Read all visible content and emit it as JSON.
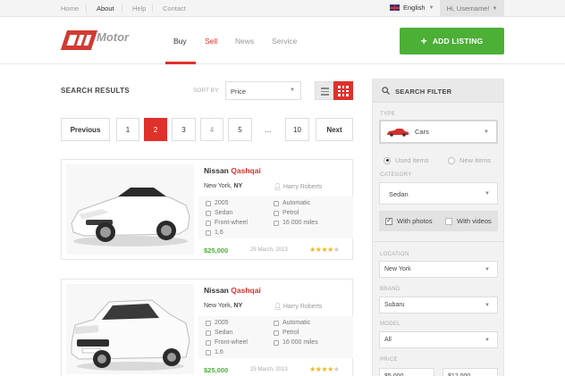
{
  "topnav": {
    "links": [
      "Home",
      "About",
      "Help",
      "Contact"
    ],
    "active": "About",
    "language": "English",
    "user": "Hi, Username!"
  },
  "header": {
    "logo_text": "Motor",
    "nav": [
      "Buy",
      "Sell",
      "News",
      "Service"
    ],
    "active_nav": "Buy",
    "add_listing": "ADD LISTING"
  },
  "results": {
    "title": "SEARCH RESULTS",
    "sort_label": "SORT BY:",
    "sort_value": "Price"
  },
  "pagination": {
    "previous": "Previous",
    "pages": [
      "1",
      "2",
      "3",
      "4",
      "5",
      "...",
      "10"
    ],
    "active_page": "2",
    "next": "Next"
  },
  "listings": [
    {
      "make": "Nissan",
      "model": "Qashqai",
      "city": "New York,",
      "state": "NY",
      "seller": "Harry Roberts",
      "year": "2005",
      "body": "Sedan",
      "drive": "Front-wheel",
      "engine": "1,6",
      "transmission": "Automatic",
      "fuel": "Petrol",
      "mileage": "16 000 miles",
      "price": "$25,000",
      "date": "25 March, 2013",
      "rating": 4
    },
    {
      "make": "Nissan",
      "model": "Qashqai",
      "city": "New York,",
      "state": "NY",
      "seller": "Harry Roberts",
      "year": "2005",
      "body": "Sedan",
      "drive": "Front-wheel",
      "engine": "1,6",
      "transmission": "Automatic",
      "fuel": "Petrol",
      "mileage": "16 000 miles",
      "price": "$25,000",
      "date": "25 March, 2013",
      "rating": 4
    }
  ],
  "filter": {
    "title": "SEARCH FILTER",
    "type_label": "TYPE",
    "type_value": "Cars",
    "used": "Used items",
    "new": "New items",
    "category_label": "CATEGORY",
    "category_value": "Sedan",
    "with_photos": "With photos",
    "with_videos": "With videos",
    "location_label": "LOCATION",
    "location_value": "New York",
    "brand_label": "BRAND",
    "brand_value": "Subaru",
    "model_label": "MODEL",
    "model_value": "All",
    "price_label": "PRICE",
    "price_min": "$5,000",
    "price_max": "$12,000"
  },
  "colors": {
    "accent": "#e0302a",
    "green": "#4caf36"
  }
}
